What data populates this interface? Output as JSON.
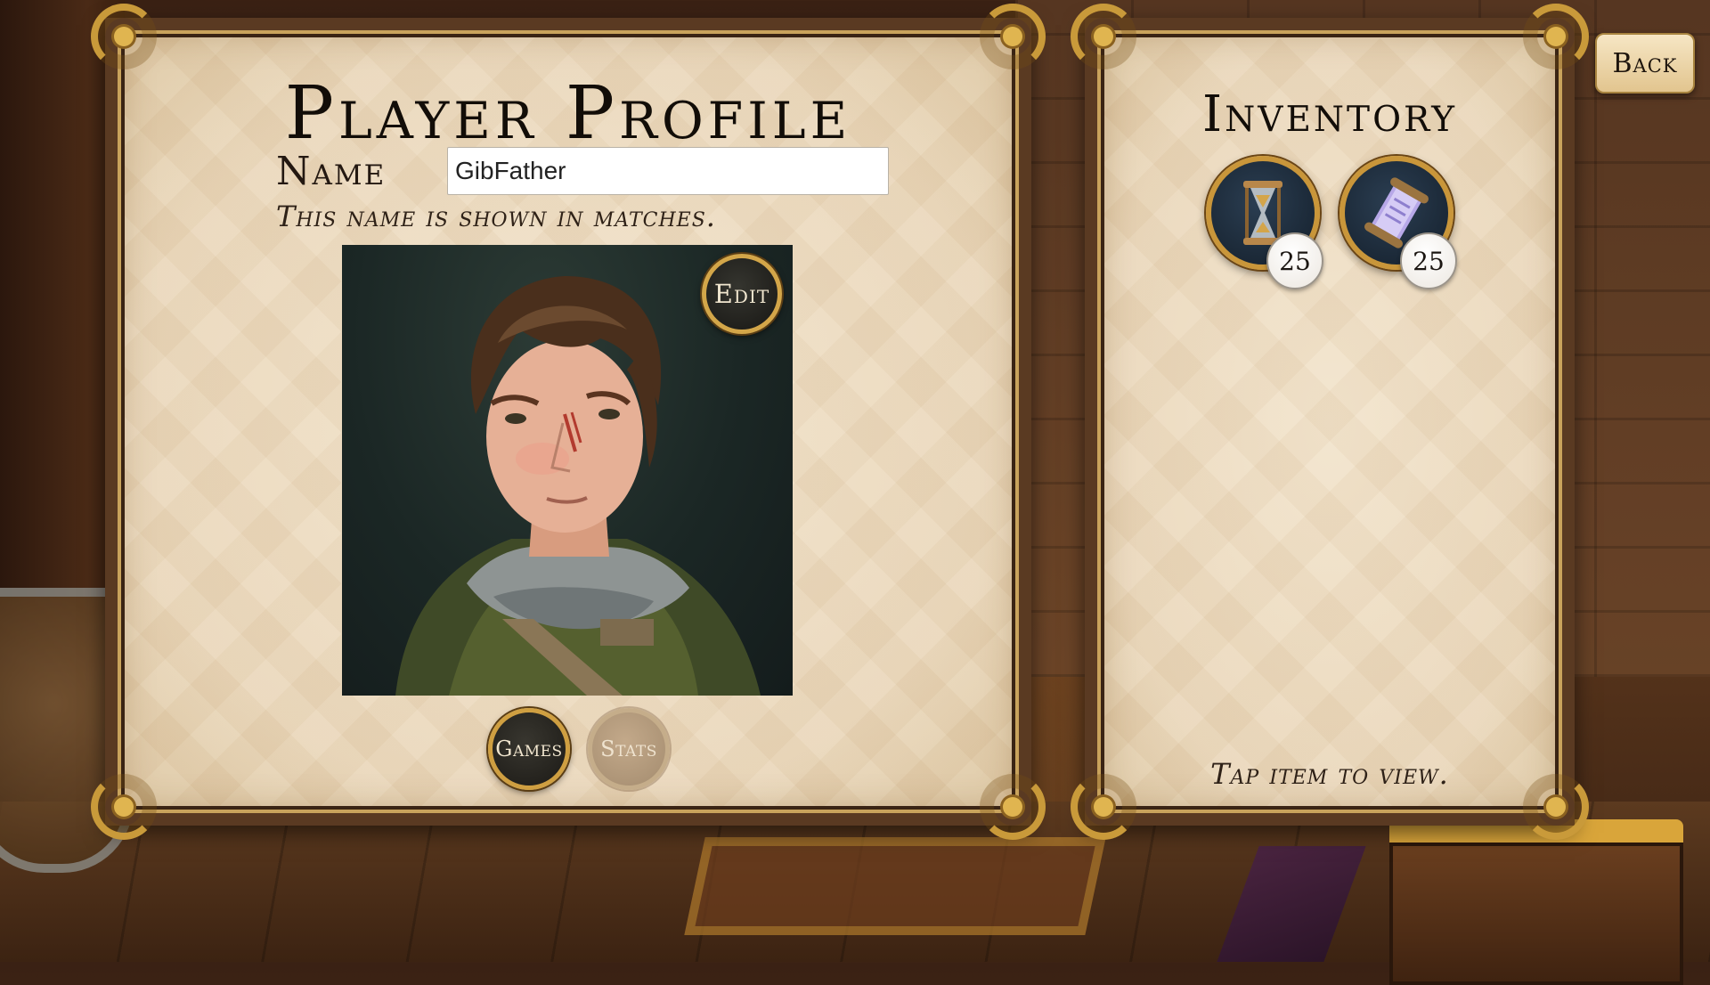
{
  "profile": {
    "title": "Player Profile",
    "name_label": "Name",
    "name_value": "GibFather",
    "name_hint": "This name is shown in matches.",
    "edit_label": "Edit",
    "games_label": "Games",
    "stats_label": "Stats"
  },
  "inventory": {
    "title": "Inventory",
    "items": [
      {
        "icon": "hourglass-icon",
        "count": "25"
      },
      {
        "icon": "scroll-icon",
        "count": "25"
      }
    ],
    "hint": "Tap item to view."
  },
  "nav": {
    "back_label": "Back"
  },
  "colors": {
    "parchment": "#ead8bb",
    "gold_trim": "#c99a3a",
    "frame_wood": "#5a3a22",
    "text_dark": "#120d08"
  }
}
